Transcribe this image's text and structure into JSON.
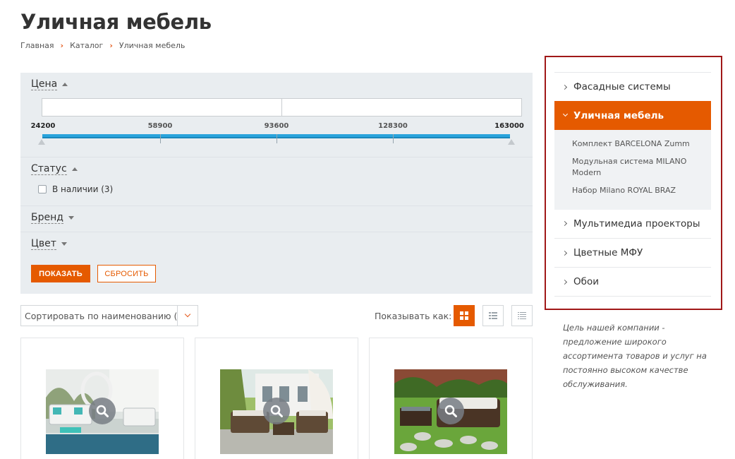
{
  "page": {
    "title": "Уличная мебель",
    "breadcrumb": [
      "Главная",
      "Каталог",
      "Уличная мебель"
    ]
  },
  "filter": {
    "price": {
      "label": "Цена",
      "min_placeholder": "",
      "max_placeholder": "",
      "ticks": [
        "24200",
        "58900",
        "93600",
        "128300",
        "163000"
      ],
      "range": [
        24200,
        163000
      ],
      "selected": [
        24200,
        163000
      ]
    },
    "status": {
      "label": "Статус",
      "option": "В наличии (3)",
      "checked": false
    },
    "brand": {
      "label": "Бренд"
    },
    "color": {
      "label": "Цвет"
    },
    "show_button": "ПОКАЗАТЬ",
    "reset_button": "СБРОСИТЬ"
  },
  "toolbar": {
    "sort_value": "Сортировать по наименованию (А",
    "view_label": "Показывать как:",
    "views": [
      "grid-icon",
      "list-icon",
      "table-icon"
    ],
    "active_view": "grid-icon"
  },
  "products": [
    {
      "image": "outdoor-sofa-pool-photo",
      "zoom": "magnifier-icon"
    },
    {
      "image": "outdoor-rattan-set-photo",
      "zoom": "magnifier-icon"
    },
    {
      "image": "outdoor-garden-sofa-photo",
      "zoom": "magnifier-icon"
    }
  ],
  "sidebar": {
    "items": [
      {
        "label": "Фасадные системы"
      },
      {
        "label": "Уличная мебель",
        "active": true,
        "children": [
          "Комплект BARCELONA Zumm",
          "Модульная система MILANO Modern",
          "Набор Milano ROYAL BRAZ"
        ]
      },
      {
        "label": "Мультимедиа проекторы"
      },
      {
        "label": "Цветные МФУ"
      },
      {
        "label": "Обои"
      }
    ],
    "about": "Цель нашей компании - предложение широкого ассортимента товаров и услуг на постоянно высоком качестве обслуживания."
  },
  "colors": {
    "accent": "#e55a00",
    "slider": "#2aa4dc",
    "panel": "#e9edf0",
    "highlight_border": "#a01818"
  }
}
